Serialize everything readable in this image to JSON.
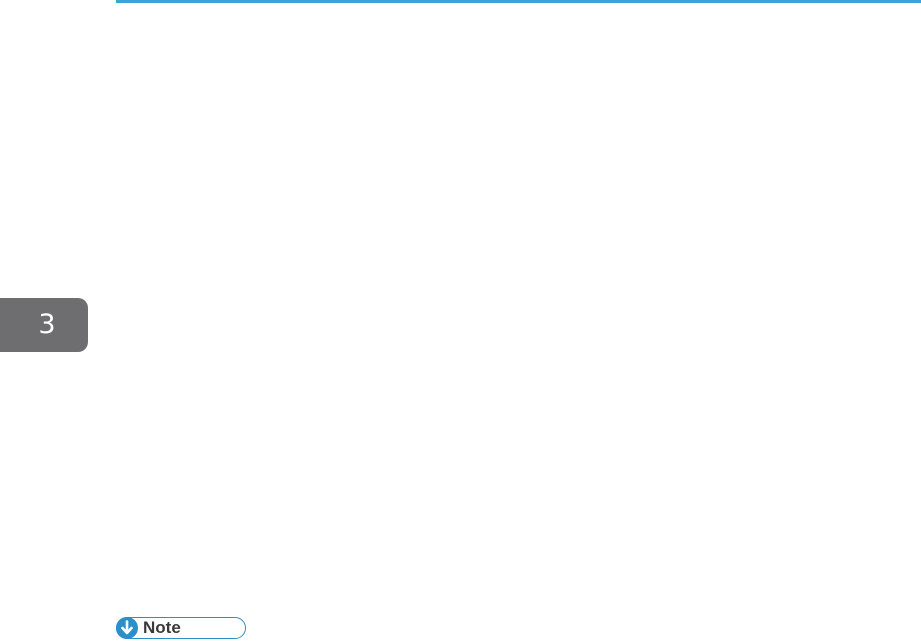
{
  "page": {
    "chapter_tab": {
      "number": "3",
      "color": "#6e6e70"
    },
    "top_rule": {
      "color": "#3aa3d8"
    },
    "note": {
      "label": "Note",
      "icon": "down-arrow-icon",
      "accent_color": "#2d8fc9"
    }
  }
}
